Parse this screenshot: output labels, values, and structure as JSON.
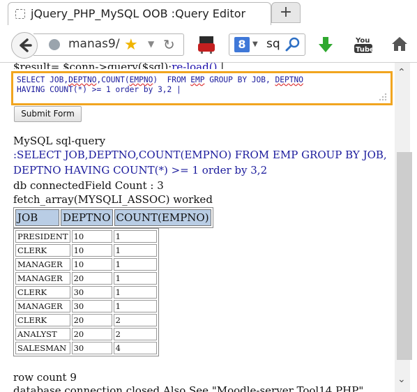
{
  "tab": {
    "title": "jQuery_PHP_MySQL OOB :Query Editor",
    "new_tab_label": "+"
  },
  "navbar": {
    "url": "manas9/",
    "search_text": "sq",
    "search_engine_letter": "8"
  },
  "page": {
    "php_line_prefix": "$result= $conn->query($sql);",
    "php_line_link": "re-load()",
    "php_line_suffix": " |",
    "sql_editor": {
      "line1_parts": [
        "SELECT JOB,",
        "DEPTNO",
        ",COUNT(",
        "EMPNO",
        ")  FROM ",
        "EMP",
        " GROUP BY JOB, ",
        "DEPTNO"
      ],
      "line2": "HAVING COUNT(*) >= 1 order by 3,2 |"
    },
    "submit_label": "Submit Form",
    "output_lines": [
      "MySQL sql-query",
      ":SELECT JOB,DEPTNO,COUNT(EMPNO) FROM EMP GROUP BY JOB,",
      "DEPTNO HAVING COUNT(*) >= 1 order by 3,2",
      "db connectedField Count : 3",
      "fetch_array(MYSQLI_ASSOC) worked"
    ],
    "table": {
      "headers": [
        "JOB",
        "DEPTNO",
        "COUNT(EMPNO)"
      ],
      "rows": [
        [
          "PRESIDENT",
          "10",
          "1"
        ],
        [
          "CLERK",
          "10",
          "1"
        ],
        [
          "MANAGER",
          "10",
          "1"
        ],
        [
          "MANAGER",
          "20",
          "1"
        ],
        [
          "CLERK",
          "30",
          "1"
        ],
        [
          "MANAGER",
          "30",
          "1"
        ],
        [
          "CLERK",
          "20",
          "2"
        ],
        [
          "ANALYST",
          "20",
          "2"
        ],
        [
          "SALESMAN",
          "30",
          "4"
        ]
      ]
    },
    "row_count": "row count 9",
    "bottom_line": "database connection closed  Also See \"Moodle-server Tool14 PHP\""
  },
  "colors": {
    "editor_border": "#f1a51f",
    "header_bg": "#b9cde5",
    "query_text": "#1a1a9c"
  }
}
